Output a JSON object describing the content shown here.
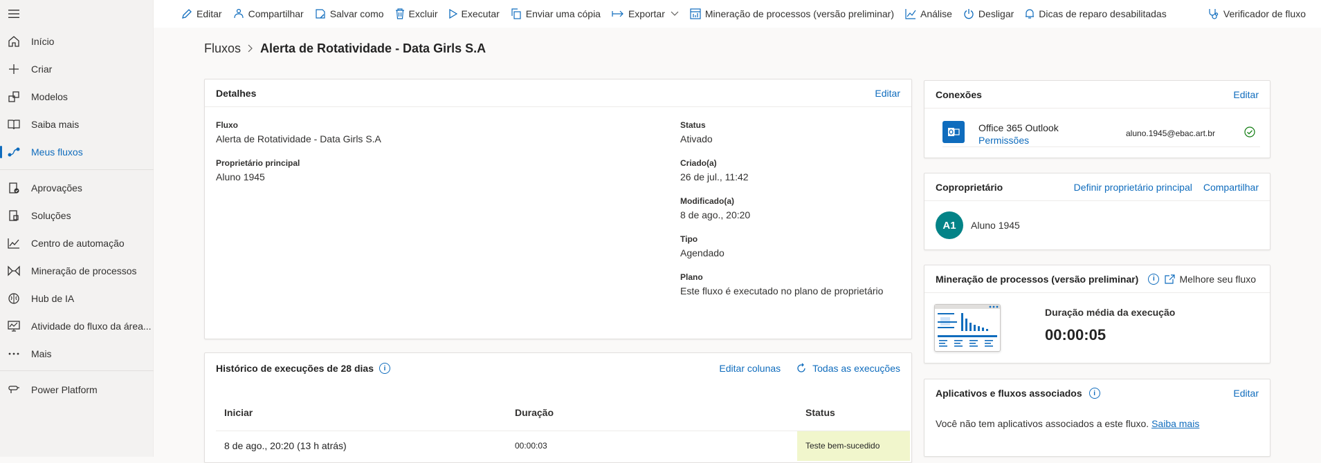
{
  "sidebar": {
    "items": [
      {
        "label": "Início",
        "icon": "home-icon"
      },
      {
        "label": "Criar",
        "icon": "plus-icon"
      },
      {
        "label": "Modelos",
        "icon": "templates-icon"
      },
      {
        "label": "Saiba mais",
        "icon": "book-icon"
      },
      {
        "label": "Meus fluxos",
        "icon": "flows-icon"
      },
      {
        "label": "Aprovações",
        "icon": "approvals-icon"
      },
      {
        "label": "Soluções",
        "icon": "solutions-icon"
      },
      {
        "label": "Centro de automação",
        "icon": "chart-line-icon"
      },
      {
        "label": "Mineração de processos",
        "icon": "process-mining-icon"
      },
      {
        "label": "Hub de IA",
        "icon": "brain-icon"
      },
      {
        "label": "Atividade do fluxo da área...",
        "icon": "desktop-activity-icon"
      },
      {
        "label": "Mais",
        "icon": "more-icon"
      },
      {
        "label": "Power Platform",
        "icon": "power-platform-icon"
      }
    ]
  },
  "toolbar": {
    "edit": "Editar",
    "share": "Compartilhar",
    "save_as": "Salvar como",
    "delete": "Excluir",
    "run": "Executar",
    "send_copy": "Enviar uma cópia",
    "export": "Exportar",
    "process_mining": "Mineração de processos (versão preliminar)",
    "analytics": "Análise",
    "turn_off": "Desligar",
    "repair_tips": "Dicas de reparo desabilitadas",
    "flow_checker": "Verificador de fluxo"
  },
  "breadcrumb": {
    "root": "Fluxos",
    "current": "Alerta de Rotatividade - Data Girls S.A"
  },
  "details": {
    "title": "Detalhes",
    "edit": "Editar",
    "flow_label": "Fluxo",
    "flow_value": "Alerta de Rotatividade - Data Girls S.A",
    "owner_label": "Proprietário principal",
    "owner_value": "Aluno 1945",
    "status_label": "Status",
    "status_value": "Ativado",
    "created_label": "Criado(a)",
    "created_value": "26 de jul., 11:42",
    "modified_label": "Modificado(a)",
    "modified_value": "8 de ago., 20:20",
    "type_label": "Tipo",
    "type_value": "Agendado",
    "plan_label": "Plano",
    "plan_value": "Este fluxo é executado no plano de proprietário"
  },
  "history": {
    "title": "Histórico de execuções de 28 dias",
    "edit_columns": "Editar colunas",
    "all_runs": "Todas as execuções",
    "columns": [
      "Iniciar",
      "Duração",
      "Status"
    ],
    "rows": [
      {
        "start": "8 de ago., 20:20 (13 h atrás)",
        "duration": "00:00:03",
        "status": "Teste bem-sucedido"
      }
    ]
  },
  "connections": {
    "title": "Conexões",
    "edit": "Editar",
    "service": "Office 365 Outlook",
    "permissions": "Permissões",
    "account": "aluno.1945@ebac.art.br"
  },
  "coowner": {
    "title": "Coproprietário",
    "set_primary": "Definir proprietário principal",
    "share": "Compartilhar",
    "avatar_initials": "A1",
    "name": "Aluno 1945",
    "avatar_color": "#038387"
  },
  "mining": {
    "title": "Mineração de processos (versão preliminar)",
    "improve": "Melhore seu fluxo",
    "avg_label": "Duração média da execução",
    "avg_value": "00:00:05"
  },
  "associated": {
    "title": "Aplicativos e fluxos associados",
    "edit": "Editar",
    "message": "Você não tem aplicativos associados a este fluxo.",
    "learn_more": "Saiba mais"
  },
  "colors": {
    "accent": "#0f6cbd",
    "success_bg": "#f1f6cc",
    "success_check": "#107c10"
  }
}
